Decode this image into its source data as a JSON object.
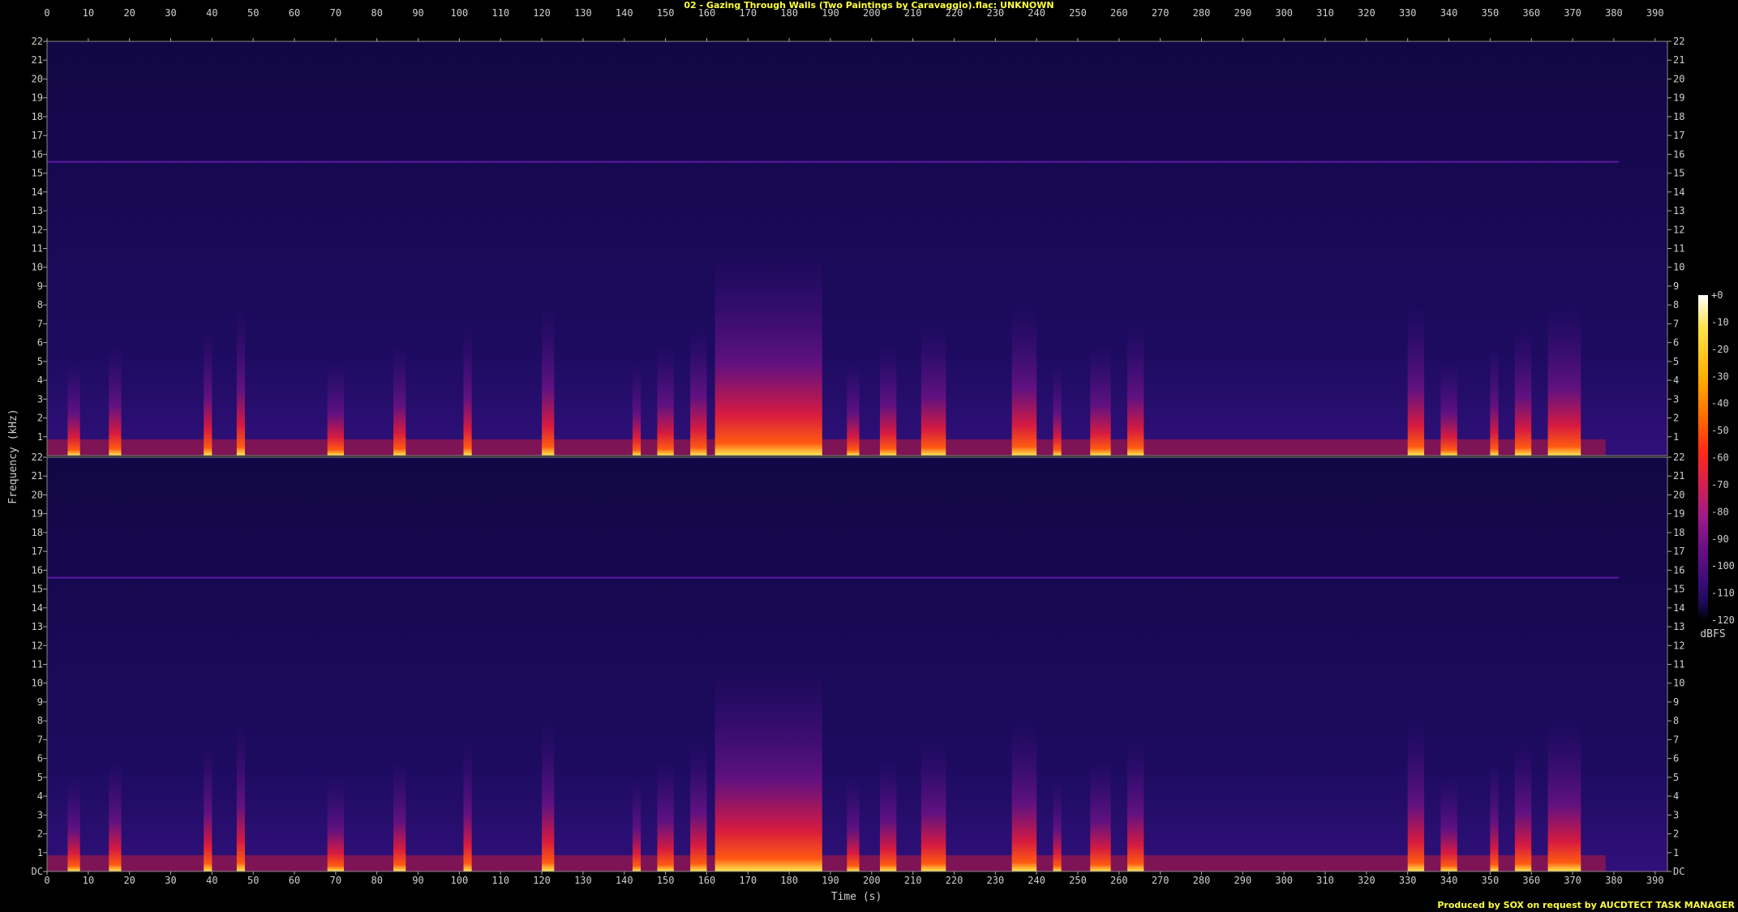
{
  "title": "02 - Gazing Through Walls (Two Paintings by Caravaggio).flac: UNKNOWN",
  "credit": "Produced by SOX on request by AUCDTECT TASK MANAGER",
  "chart_data": {
    "type": "heatmap",
    "subtype": "spectrogram",
    "channels": 2,
    "xlabel": "Time (s)",
    "ylabel": "Frequency (kHz)",
    "xlim": [
      0,
      393
    ],
    "ylim": [
      0,
      22
    ],
    "x_ticks": [
      "0",
      "10",
      "20",
      "30",
      "40",
      "50",
      "60",
      "70",
      "80",
      "90",
      "100",
      "110",
      "120",
      "130",
      "140",
      "150",
      "160",
      "170",
      "180",
      "190",
      "200",
      "210",
      "220",
      "230",
      "240",
      "250",
      "260",
      "270",
      "280",
      "290",
      "300",
      "310",
      "320",
      "330",
      "340",
      "350",
      "360",
      "370",
      "380",
      "390"
    ],
    "y_ticks_top": [
      "1",
      "2",
      "3",
      "4",
      "5",
      "6",
      "7",
      "8",
      "9",
      "10",
      "11",
      "12",
      "13",
      "14",
      "15",
      "16",
      "17",
      "18",
      "19",
      "20",
      "21",
      "22"
    ],
    "y_ticks_bottom": [
      "DC",
      "1",
      "2",
      "3",
      "4",
      "5",
      "6",
      "7",
      "8",
      "9",
      "10",
      "11",
      "12",
      "13",
      "14",
      "15",
      "16",
      "17",
      "18",
      "19",
      "20",
      "21",
      "22"
    ],
    "colorbar_label": "dBFS",
    "colorbar_ticks": [
      "+0",
      "-10",
      "-20",
      "-30",
      "-40",
      "-50",
      "-60",
      "-70",
      "-80",
      "-90",
      "-100",
      "-110",
      "-120"
    ],
    "colorbar_range_dbfs": [
      -120,
      0
    ],
    "colormap": [
      "#000000",
      "#1b0a55",
      "#3a0c7a",
      "#6a0f86",
      "#a11a8a",
      "#d6204f",
      "#ff2a17",
      "#ff6a00",
      "#ffb000",
      "#ffe24a",
      "#ffffff"
    ],
    "loud_segments_s": [
      [
        5,
        8
      ],
      [
        15,
        18
      ],
      [
        38,
        40
      ],
      [
        46,
        48
      ],
      [
        68,
        72
      ],
      [
        84,
        87
      ],
      [
        101,
        103
      ],
      [
        120,
        123
      ],
      [
        142,
        144
      ],
      [
        148,
        152
      ],
      [
        156,
        160
      ],
      [
        162,
        188
      ],
      [
        194,
        197
      ],
      [
        202,
        206
      ],
      [
        212,
        218
      ],
      [
        234,
        240
      ],
      [
        244,
        246
      ],
      [
        253,
        258
      ],
      [
        262,
        266
      ],
      [
        330,
        334
      ],
      [
        338,
        342
      ],
      [
        350,
        352
      ],
      [
        356,
        360
      ],
      [
        364,
        372
      ]
    ],
    "tone_line_khz": 15.6
  }
}
